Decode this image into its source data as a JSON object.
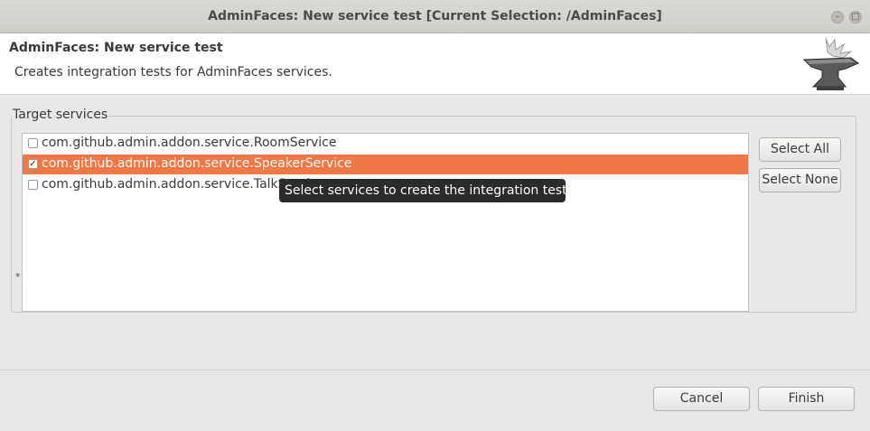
{
  "window": {
    "title": "AdminFaces: New service test [Current Selection: /AdminFaces]",
    "minimize_icon": "minimize-icon",
    "maximize_icon": "maximize-icon"
  },
  "header": {
    "title": "AdminFaces: New service test",
    "description": "Creates integration tests for AdminFaces services.",
    "icon": "anvil-icon"
  },
  "target_services": {
    "label": "Target services",
    "items": [
      {
        "label": "com.github.admin.addon.service.RoomService",
        "checked": false
      },
      {
        "label": "com.github.admin.addon.service.SpeakerService",
        "checked": true
      },
      {
        "label": "com.github.admin.addon.service.TalkService",
        "checked": false
      }
    ],
    "required_marker": "*",
    "select_all_label": "Select All",
    "select_none_label": "Select None"
  },
  "tooltip": {
    "text": "Select services to create the integration tests."
  },
  "footer": {
    "cancel_label": "Cancel",
    "finish_label": "Finish"
  },
  "colors": {
    "selection": "#f07746",
    "tooltip_bg": "#2b2b2b"
  }
}
